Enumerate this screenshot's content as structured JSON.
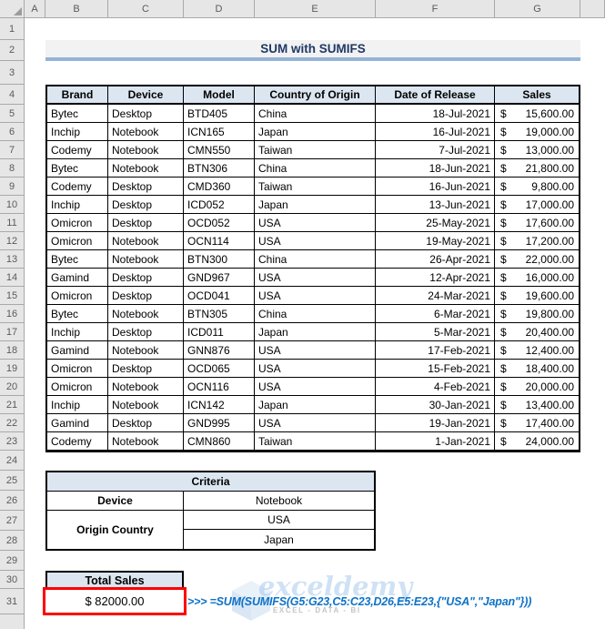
{
  "sheet": {
    "columns": [
      "A",
      "B",
      "C",
      "D",
      "E",
      "F",
      "G"
    ],
    "rows": [
      1,
      2,
      3,
      4,
      5,
      6,
      7,
      8,
      9,
      10,
      11,
      12,
      13,
      14,
      15,
      16,
      17,
      18,
      19,
      20,
      21,
      22,
      23,
      24,
      25,
      26,
      27,
      28,
      29,
      30,
      31
    ]
  },
  "title": "SUM with SUMIFS",
  "main_table": {
    "headers": [
      "Brand",
      "Device",
      "Model",
      "Country of Origin",
      "Date of Release",
      "Sales"
    ],
    "currency_symbol": "$",
    "rows": [
      [
        "Bytec",
        "Desktop",
        "BTD405",
        "China",
        "18-Jul-2021",
        "15,600.00"
      ],
      [
        "Inchip",
        "Notebook",
        "ICN165",
        "Japan",
        "16-Jul-2021",
        "19,000.00"
      ],
      [
        "Codemy",
        "Notebook",
        "CMN550",
        "Taiwan",
        "7-Jul-2021",
        "13,000.00"
      ],
      [
        "Bytec",
        "Notebook",
        "BTN306",
        "China",
        "18-Jun-2021",
        "21,800.00"
      ],
      [
        "Codemy",
        "Desktop",
        "CMD360",
        "Taiwan",
        "16-Jun-2021",
        "9,800.00"
      ],
      [
        "Inchip",
        "Desktop",
        "ICD052",
        "Japan",
        "13-Jun-2021",
        "17,000.00"
      ],
      [
        "Omicron",
        "Desktop",
        "OCD052",
        "USA",
        "25-May-2021",
        "17,600.00"
      ],
      [
        "Omicron",
        "Notebook",
        "OCN114",
        "USA",
        "19-May-2021",
        "17,200.00"
      ],
      [
        "Bytec",
        "Notebook",
        "BTN300",
        "China",
        "26-Apr-2021",
        "22,000.00"
      ],
      [
        "Gamind",
        "Desktop",
        "GND967",
        "USA",
        "12-Apr-2021",
        "16,000.00"
      ],
      [
        "Omicron",
        "Desktop",
        "OCD041",
        "USA",
        "24-Mar-2021",
        "19,600.00"
      ],
      [
        "Bytec",
        "Notebook",
        "BTN305",
        "China",
        "6-Mar-2021",
        "19,800.00"
      ],
      [
        "Inchip",
        "Desktop",
        "ICD011",
        "Japan",
        "5-Mar-2021",
        "20,400.00"
      ],
      [
        "Gamind",
        "Notebook",
        "GNN876",
        "USA",
        "17-Feb-2021",
        "12,400.00"
      ],
      [
        "Omicron",
        "Desktop",
        "OCD065",
        "USA",
        "15-Feb-2021",
        "18,400.00"
      ],
      [
        "Omicron",
        "Notebook",
        "OCN116",
        "USA",
        "4-Feb-2021",
        "20,000.00"
      ],
      [
        "Inchip",
        "Notebook",
        "ICN142",
        "Japan",
        "30-Jan-2021",
        "13,400.00"
      ],
      [
        "Gamind",
        "Desktop",
        "GND995",
        "USA",
        "19-Jan-2021",
        "17,400.00"
      ],
      [
        "Codemy",
        "Notebook",
        "CMN860",
        "Taiwan",
        "1-Jan-2021",
        "24,000.00"
      ]
    ]
  },
  "criteria": {
    "title": "Criteria",
    "device_label": "Device",
    "device_value": "Notebook",
    "origin_label": "Origin Country",
    "origin_values": [
      "USA",
      "Japan"
    ]
  },
  "total": {
    "label": "Total Sales",
    "value_display": "$ 82000.00"
  },
  "formula": {
    "display": ">>> =SUM(SUMIFS(G5:G23,C5:C23,D26,E5:E23,{\"USA\",\"Japan\"}))"
  },
  "watermark": {
    "script_text": "exceldemy",
    "caption": "EXCEL - DATA - BI"
  },
  "colors": {
    "accent_blue": "#95B3D7",
    "header_fill": "#DCE6F1",
    "title_color": "#1F3864",
    "formula_blue": "#0E72C6",
    "highlight_red": "#FE0000",
    "chrome_fill": "#E6E6E6",
    "chrome_line": "#A9A9A9"
  }
}
